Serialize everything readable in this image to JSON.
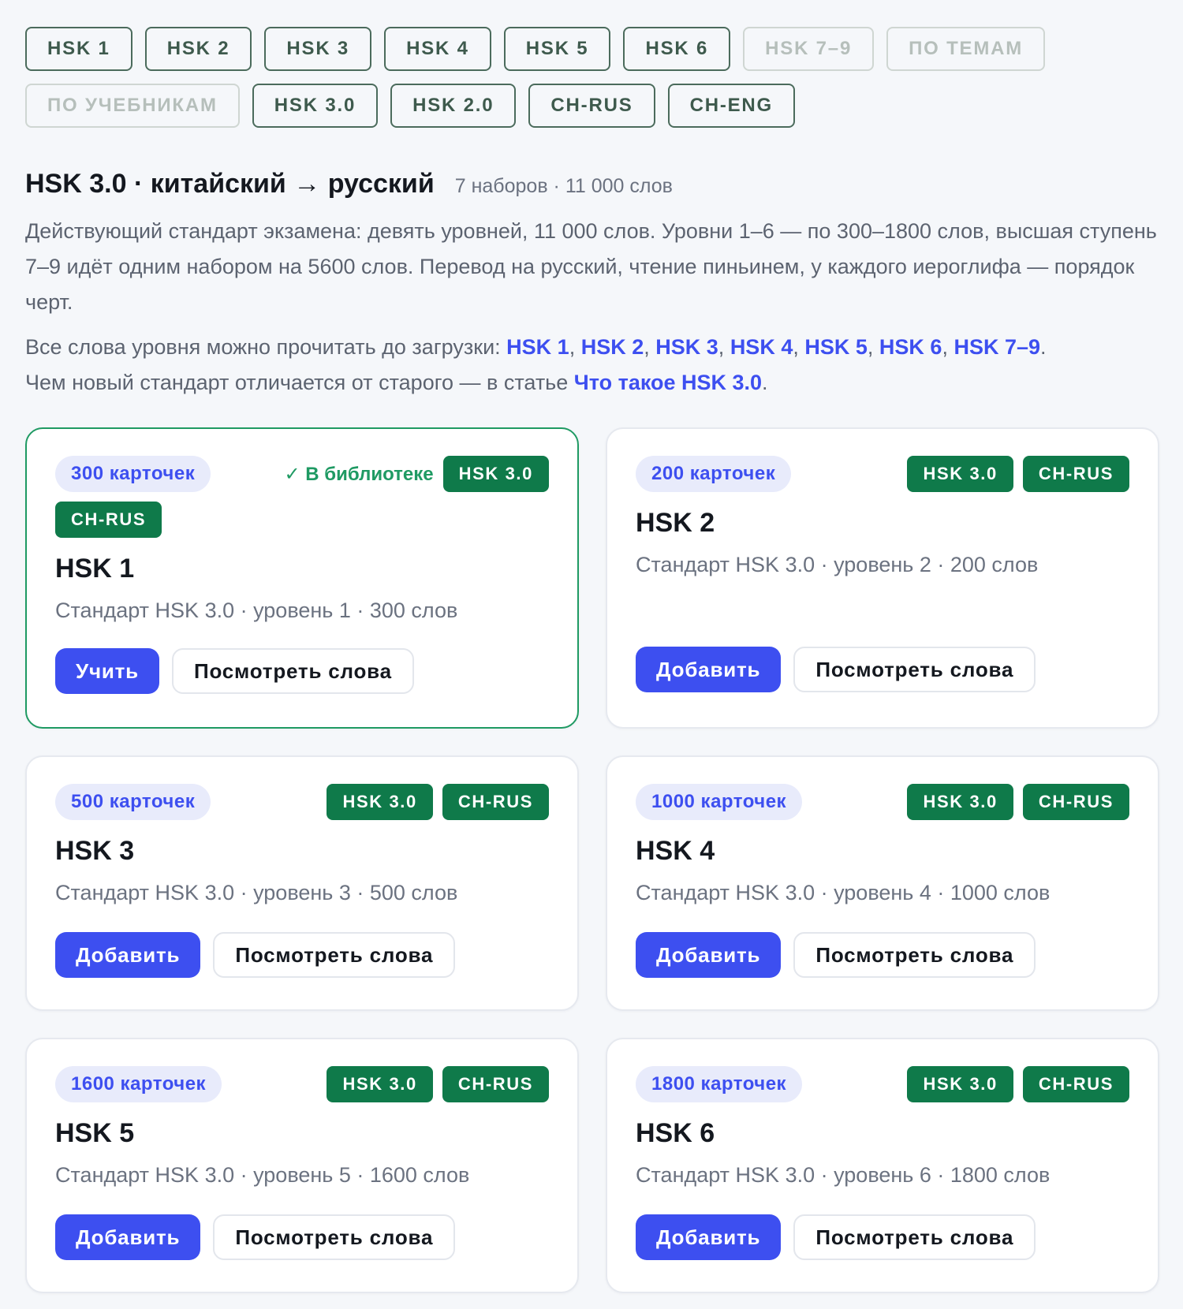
{
  "filters": [
    {
      "label": "HSK 1",
      "dim": false
    },
    {
      "label": "HSK 2",
      "dim": false
    },
    {
      "label": "HSK 3",
      "dim": false
    },
    {
      "label": "HSK 4",
      "dim": false
    },
    {
      "label": "HSK 5",
      "dim": false
    },
    {
      "label": "HSK 6",
      "dim": false
    },
    {
      "label": "HSK 7–9",
      "dim": true
    },
    {
      "label": "ПО ТЕМАМ",
      "dim": true
    },
    {
      "label": "ПО УЧЕБНИКАМ",
      "dim": true
    },
    {
      "label": "HSK 3.0",
      "dim": false
    },
    {
      "label": "HSK 2.0",
      "dim": false
    },
    {
      "label": "CH-RUS",
      "dim": false
    },
    {
      "label": "CH-ENG",
      "dim": false
    }
  ],
  "heading": {
    "title": "HSK 3.0 · китайский → русский",
    "meta": "7 наборов · 11 000 слов"
  },
  "description": "Действующий стандарт экзамена: девять уровней, 11 000 слов. Уровни 1–6 — по 300–1800 слов, высшая ступень 7–9 идёт одним набором на 5600 слов. Перевод на русский, чтение пиньинем, у каждого иероглифа — порядок черт.",
  "links_line": {
    "prefix": "Все слова уровня можно прочитать до загрузки: ",
    "levels": [
      "HSK 1",
      "HSK 2",
      "HSK 3",
      "HSK 4",
      "HSK 5",
      "HSK 6",
      "HSK 7–9"
    ],
    "separator": ", ",
    "end": ".",
    "article_prefix": "Чем новый стандарт отличается от старого — в статье ",
    "article_link": "Что такое HSK 3.0",
    "article_end": "."
  },
  "cards": [
    {
      "count": "300 карточек",
      "in_library": "✓ В библиотеке",
      "badges": [
        "HSK 3.0",
        "CH-RUS"
      ],
      "title": "HSK 1",
      "subtitle": "Стандарт HSK 3.0 · уровень 1 · 300 слов",
      "primary": "Учить",
      "secondary": "Посмотреть слова"
    },
    {
      "count": "200 карточек",
      "badges": [
        "HSK 3.0",
        "CH-RUS"
      ],
      "title": "HSK 2",
      "subtitle": "Стандарт HSK 3.0 · уровень 2 · 200 слов",
      "primary": "Добавить",
      "secondary": "Посмотреть слова"
    },
    {
      "count": "500 карточек",
      "badges": [
        "HSK 3.0",
        "CH-RUS"
      ],
      "title": "HSK 3",
      "subtitle": "Стандарт HSK 3.0 · уровень 3 · 500 слов",
      "primary": "Добавить",
      "secondary": "Посмотреть слова"
    },
    {
      "count": "1000 карточек",
      "badges": [
        "HSK 3.0",
        "CH-RUS"
      ],
      "title": "HSK 4",
      "subtitle": "Стандарт HSK 3.0 · уровень 4 · 1000 слов",
      "primary": "Добавить",
      "secondary": "Посмотреть слова"
    },
    {
      "count": "1600 карточек",
      "badges": [
        "HSK 3.0",
        "CH-RUS"
      ],
      "title": "HSK 5",
      "subtitle": "Стандарт HSK 3.0 · уровень 5 · 1600 слов",
      "primary": "Добавить",
      "secondary": "Посмотреть слова"
    },
    {
      "count": "1800 карточек",
      "badges": [
        "HSK 3.0",
        "CH-RUS"
      ],
      "title": "HSK 6",
      "subtitle": "Стандарт HSK 3.0 · уровень 6 · 1800 слов",
      "primary": "Добавить",
      "secondary": "Посмотреть слова"
    }
  ],
  "colors": {
    "accent": "#3d4ff0",
    "badge_green": "#0f7a4a",
    "library_green": "#1f9a63",
    "chip_border": "#4b6b5c"
  }
}
